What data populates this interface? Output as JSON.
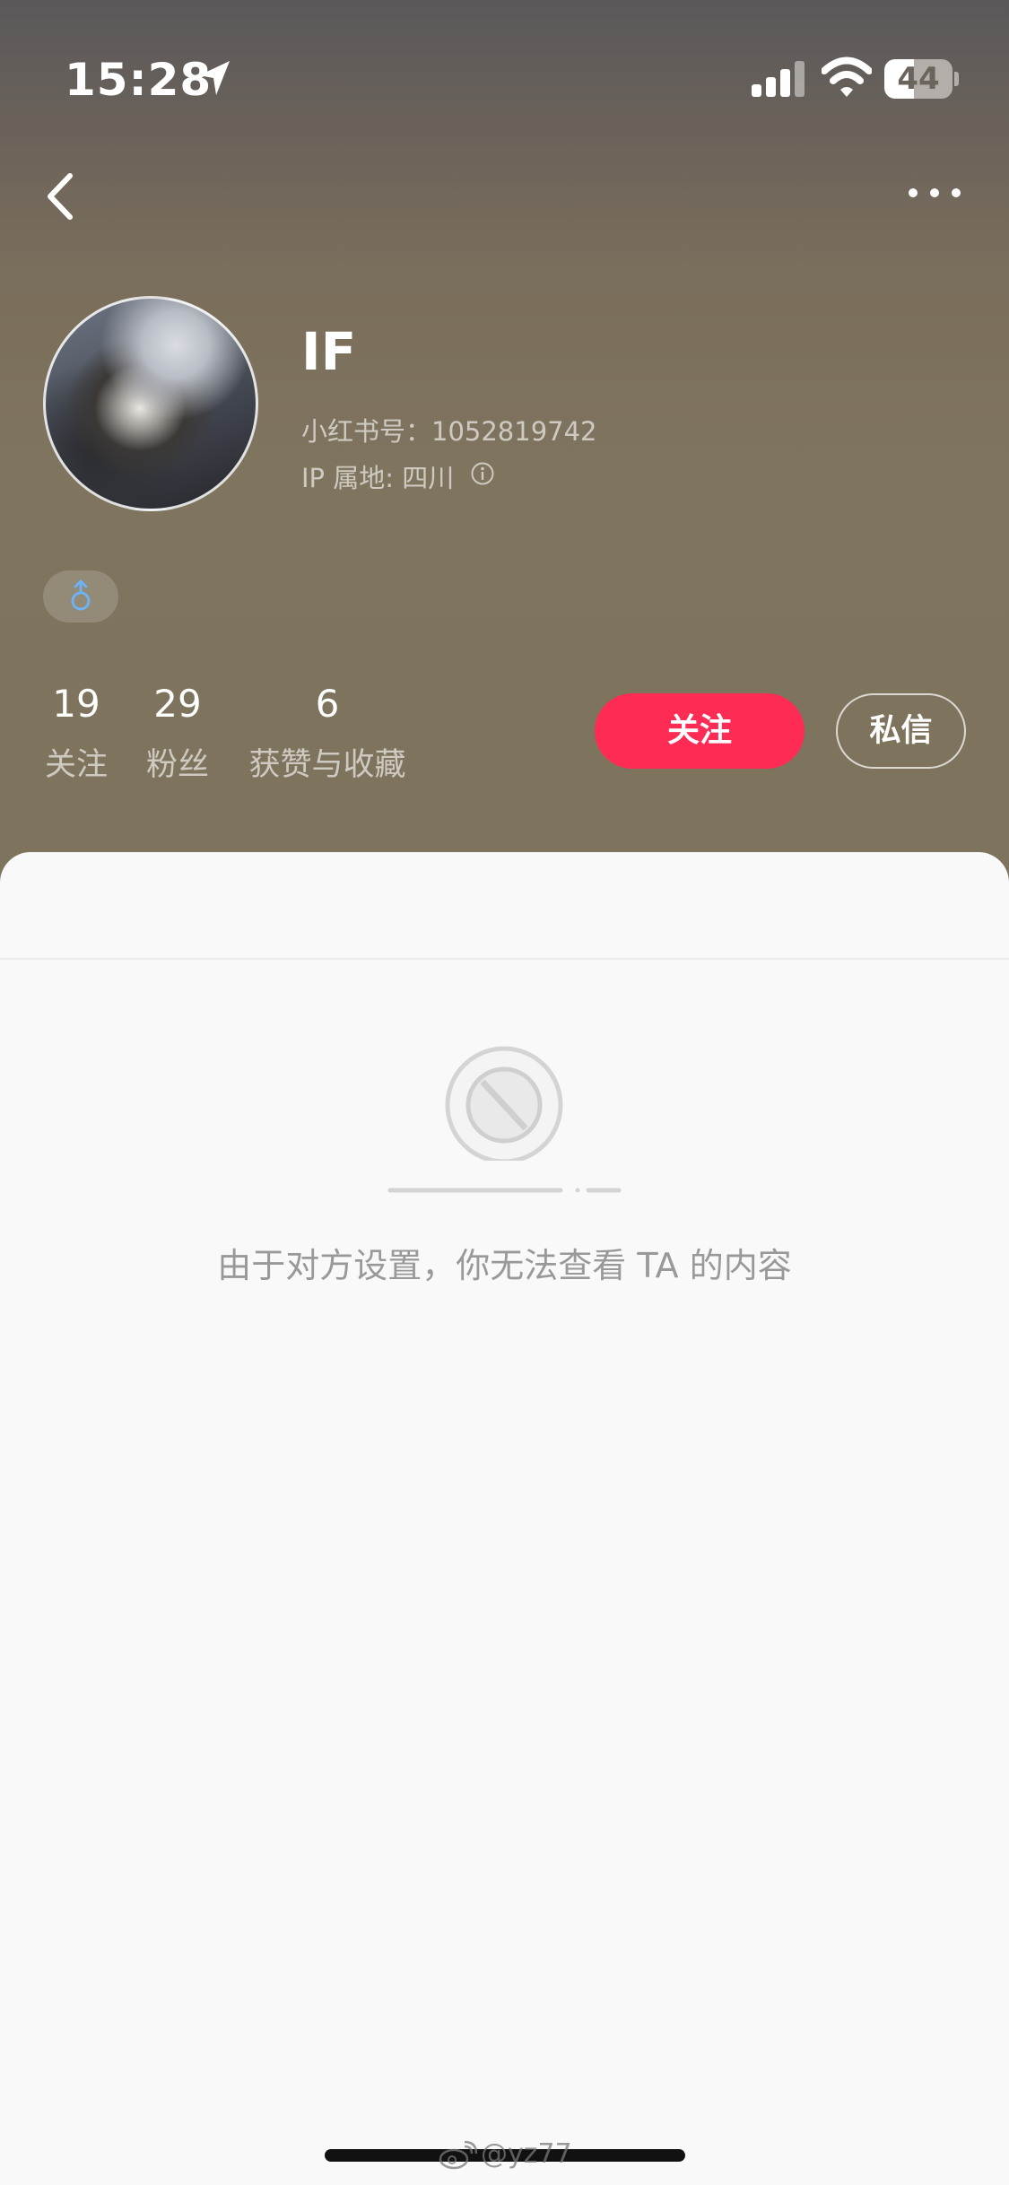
{
  "status_bar": {
    "time": "15:28",
    "battery": "44",
    "battery_level_percent": 44,
    "icons": [
      "location-arrow-icon",
      "cellular-signal-icon",
      "wifi-icon",
      "battery-icon"
    ]
  },
  "nav": {
    "back_icon": "chevron-left-icon",
    "more_icon": "ellipsis-icon"
  },
  "profile": {
    "name": "IF",
    "user_id": "小红书号：1052819742",
    "ip_location": "IP 属地: 四川",
    "gender_icon": "male-icon",
    "stats": [
      {
        "value": "19",
        "label": "关注"
      },
      {
        "value": "29",
        "label": "粉丝"
      },
      {
        "value": "6",
        "label": "获赞与收藏"
      }
    ],
    "follow_label": "关注",
    "message_label": "私信"
  },
  "content": {
    "blocked_message": "由于对方设置，你无法查看 TA 的内容",
    "illustration_icon": "prohibited-sign-icon"
  },
  "watermark": "@yz77",
  "colors": {
    "accent": "#fe2c55",
    "header_bg": "#7e745d",
    "content_bg": "#f9f9f9"
  }
}
